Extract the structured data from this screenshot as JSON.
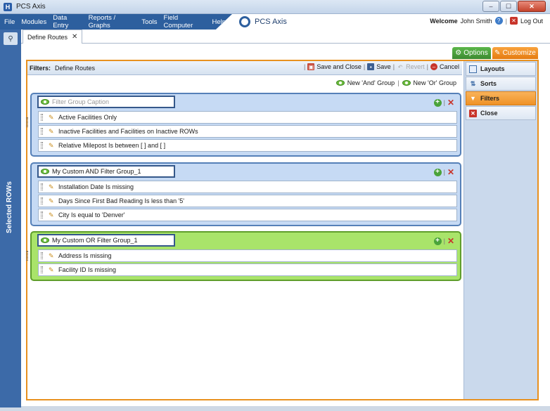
{
  "window": {
    "title": "PCS Axis"
  },
  "menu": {
    "items": [
      "File",
      "Modules",
      "Data Entry",
      "Reports / Graphs",
      "Tools",
      "Field Computer",
      "Help"
    ]
  },
  "brand": {
    "name": "PCS Axis"
  },
  "user": {
    "welcome": "Welcome",
    "name": "John Smith",
    "logout": "Log Out"
  },
  "left_rail": {
    "label": "Selected ROWs"
  },
  "doc_tab": {
    "label": "Define Routes",
    "close": "✕"
  },
  "panel_tabs": {
    "options": "Options",
    "customize": "Customize"
  },
  "filters_panel": {
    "label": "Filters:",
    "name": "Define Routes",
    "save_close": "Save and Close",
    "save": "Save",
    "revert": "Revert",
    "cancel": "Cancel",
    "new_and": "New 'And' Group",
    "new_or": "New 'Or' Group"
  },
  "groups": [
    {
      "caption": "Filter Group Caption",
      "is_placeholder": true,
      "color": "blue",
      "rows": [
        "Active Facilities Only",
        "Inactive Facilities and Facilities on Inactive ROWs",
        "Relative Milepost Is between [            ] and [            ]"
      ]
    },
    {
      "caption": "My Custom AND Filter Group_1",
      "is_placeholder": false,
      "color": "blue",
      "rows": [
        "Installation Date Is missing",
        "Days Since First Bad Reading Is less than '5'",
        "City Is equal to 'Denver'"
      ]
    },
    {
      "caption": "My Custom OR Filter Group_1",
      "is_placeholder": false,
      "color": "green",
      "rows": [
        "Address Is missing",
        "Facility ID Is missing"
      ]
    }
  ],
  "right_nav": {
    "items": [
      "Layouts",
      "Sorts",
      "Filters",
      "Close"
    ],
    "active": "Filters"
  },
  "colors": {
    "accent_orange": "#e8911f",
    "group_blue": "#c6daf4",
    "group_green": "#a9e46a",
    "menu_blue": "#2d5f9e"
  }
}
